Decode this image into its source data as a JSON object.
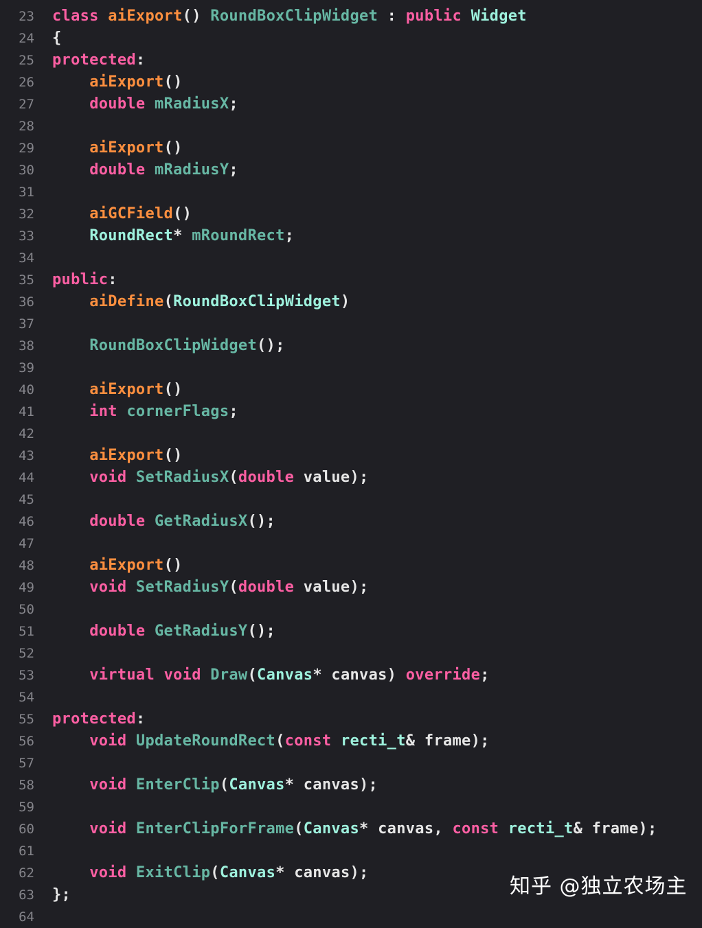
{
  "lines": [
    {
      "n": "23",
      "tokens": [
        [
          "kw",
          "class"
        ],
        [
          "id",
          " "
        ],
        [
          "mc",
          "aiExport"
        ],
        [
          "id",
          "() "
        ],
        [
          "fn",
          "RoundBoxClipWidget"
        ],
        [
          "id",
          " : "
        ],
        [
          "kw",
          "public"
        ],
        [
          "id",
          " "
        ],
        [
          "ty",
          "Widget"
        ]
      ]
    },
    {
      "n": "24",
      "tokens": [
        [
          "id",
          "{"
        ]
      ]
    },
    {
      "n": "25",
      "tokens": [
        [
          "kw",
          "protected"
        ],
        [
          "id",
          ":"
        ]
      ]
    },
    {
      "n": "26",
      "tokens": [
        [
          "id",
          "    "
        ],
        [
          "mc",
          "aiExport"
        ],
        [
          "id",
          "()"
        ]
      ]
    },
    {
      "n": "27",
      "tokens": [
        [
          "id",
          "    "
        ],
        [
          "kw",
          "double"
        ],
        [
          "id",
          " "
        ],
        [
          "fn",
          "mRadiusX"
        ],
        [
          "id",
          ";"
        ]
      ]
    },
    {
      "n": "28",
      "tokens": []
    },
    {
      "n": "29",
      "tokens": [
        [
          "id",
          "    "
        ],
        [
          "mc",
          "aiExport"
        ],
        [
          "id",
          "()"
        ]
      ]
    },
    {
      "n": "30",
      "tokens": [
        [
          "id",
          "    "
        ],
        [
          "kw",
          "double"
        ],
        [
          "id",
          " "
        ],
        [
          "fn",
          "mRadiusY"
        ],
        [
          "id",
          ";"
        ]
      ]
    },
    {
      "n": "31",
      "tokens": []
    },
    {
      "n": "32",
      "tokens": [
        [
          "id",
          "    "
        ],
        [
          "mc",
          "aiGCField"
        ],
        [
          "id",
          "()"
        ]
      ]
    },
    {
      "n": "33",
      "tokens": [
        [
          "id",
          "    "
        ],
        [
          "ty",
          "RoundRect"
        ],
        [
          "id",
          "* "
        ],
        [
          "fn",
          "mRoundRect"
        ],
        [
          "id",
          ";"
        ]
      ]
    },
    {
      "n": "34",
      "tokens": []
    },
    {
      "n": "35",
      "tokens": [
        [
          "kw",
          "public"
        ],
        [
          "id",
          ":"
        ]
      ]
    },
    {
      "n": "36",
      "tokens": [
        [
          "id",
          "    "
        ],
        [
          "mc",
          "aiDefine"
        ],
        [
          "id",
          "("
        ],
        [
          "ty",
          "RoundBoxClipWidget"
        ],
        [
          "id",
          ")"
        ]
      ]
    },
    {
      "n": "37",
      "tokens": []
    },
    {
      "n": "38",
      "tokens": [
        [
          "id",
          "    "
        ],
        [
          "fn",
          "RoundBoxClipWidget"
        ],
        [
          "id",
          "();"
        ]
      ]
    },
    {
      "n": "39",
      "tokens": []
    },
    {
      "n": "40",
      "tokens": [
        [
          "id",
          "    "
        ],
        [
          "mc",
          "aiExport"
        ],
        [
          "id",
          "()"
        ]
      ]
    },
    {
      "n": "41",
      "tokens": [
        [
          "id",
          "    "
        ],
        [
          "kw",
          "int"
        ],
        [
          "id",
          " "
        ],
        [
          "fn",
          "cornerFlags"
        ],
        [
          "id",
          ";"
        ]
      ]
    },
    {
      "n": "42",
      "tokens": []
    },
    {
      "n": "43",
      "tokens": [
        [
          "id",
          "    "
        ],
        [
          "mc",
          "aiExport"
        ],
        [
          "id",
          "()"
        ]
      ]
    },
    {
      "n": "44",
      "tokens": [
        [
          "id",
          "    "
        ],
        [
          "kw",
          "void"
        ],
        [
          "id",
          " "
        ],
        [
          "fn",
          "SetRadiusX"
        ],
        [
          "id",
          "("
        ],
        [
          "kw",
          "double"
        ],
        [
          "id",
          " value);"
        ]
      ]
    },
    {
      "n": "45",
      "tokens": []
    },
    {
      "n": "46",
      "tokens": [
        [
          "id",
          "    "
        ],
        [
          "kw",
          "double"
        ],
        [
          "id",
          " "
        ],
        [
          "fn",
          "GetRadiusX"
        ],
        [
          "id",
          "();"
        ]
      ]
    },
    {
      "n": "47",
      "tokens": []
    },
    {
      "n": "48",
      "tokens": [
        [
          "id",
          "    "
        ],
        [
          "mc",
          "aiExport"
        ],
        [
          "id",
          "()"
        ]
      ]
    },
    {
      "n": "49",
      "tokens": [
        [
          "id",
          "    "
        ],
        [
          "kw",
          "void"
        ],
        [
          "id",
          " "
        ],
        [
          "fn",
          "SetRadiusY"
        ],
        [
          "id",
          "("
        ],
        [
          "kw",
          "double"
        ],
        [
          "id",
          " value);"
        ]
      ]
    },
    {
      "n": "50",
      "tokens": []
    },
    {
      "n": "51",
      "tokens": [
        [
          "id",
          "    "
        ],
        [
          "kw",
          "double"
        ],
        [
          "id",
          " "
        ],
        [
          "fn",
          "GetRadiusY"
        ],
        [
          "id",
          "();"
        ]
      ]
    },
    {
      "n": "52",
      "tokens": []
    },
    {
      "n": "53",
      "tokens": [
        [
          "id",
          "    "
        ],
        [
          "kw",
          "virtual"
        ],
        [
          "id",
          " "
        ],
        [
          "kw",
          "void"
        ],
        [
          "id",
          " "
        ],
        [
          "fn",
          "Draw"
        ],
        [
          "id",
          "("
        ],
        [
          "ty",
          "Canvas"
        ],
        [
          "id",
          "* canvas) "
        ],
        [
          "kw",
          "override"
        ],
        [
          "id",
          ";"
        ]
      ]
    },
    {
      "n": "54",
      "tokens": []
    },
    {
      "n": "55",
      "tokens": [
        [
          "kw",
          "protected"
        ],
        [
          "id",
          ":"
        ]
      ]
    },
    {
      "n": "56",
      "tokens": [
        [
          "id",
          "    "
        ],
        [
          "kw",
          "void"
        ],
        [
          "id",
          " "
        ],
        [
          "fn",
          "UpdateRoundRect"
        ],
        [
          "id",
          "("
        ],
        [
          "kw",
          "const"
        ],
        [
          "id",
          " "
        ],
        [
          "ty",
          "recti_t"
        ],
        [
          "id",
          "& frame);"
        ]
      ]
    },
    {
      "n": "57",
      "tokens": []
    },
    {
      "n": "58",
      "tokens": [
        [
          "id",
          "    "
        ],
        [
          "kw",
          "void"
        ],
        [
          "id",
          " "
        ],
        [
          "fn",
          "EnterClip"
        ],
        [
          "id",
          "("
        ],
        [
          "ty",
          "Canvas"
        ],
        [
          "id",
          "* canvas);"
        ]
      ]
    },
    {
      "n": "59",
      "tokens": []
    },
    {
      "n": "60",
      "tokens": [
        [
          "id",
          "    "
        ],
        [
          "kw",
          "void"
        ],
        [
          "id",
          " "
        ],
        [
          "fn",
          "EnterClipForFrame"
        ],
        [
          "id",
          "("
        ],
        [
          "ty",
          "Canvas"
        ],
        [
          "id",
          "* canvas, "
        ],
        [
          "kw",
          "const"
        ],
        [
          "id",
          " "
        ],
        [
          "ty",
          "recti_t"
        ],
        [
          "id",
          "& frame);"
        ]
      ]
    },
    {
      "n": "61",
      "tokens": []
    },
    {
      "n": "62",
      "tokens": [
        [
          "id",
          "    "
        ],
        [
          "kw",
          "void"
        ],
        [
          "id",
          " "
        ],
        [
          "fn",
          "ExitClip"
        ],
        [
          "id",
          "("
        ],
        [
          "ty",
          "Canvas"
        ],
        [
          "id",
          "* canvas);"
        ]
      ]
    },
    {
      "n": "63",
      "tokens": [
        [
          "id",
          "};"
        ]
      ]
    },
    {
      "n": "64",
      "tokens": []
    }
  ],
  "watermark": "知乎 @独立农场主",
  "colors": {
    "background": "#1f1f24",
    "keyword": "#fc5fa3",
    "macro": "#fd8f3f",
    "type": "#9ef1dd",
    "function": "#67b7a4",
    "plain": "#e6e6e6",
    "line_number": "#84848a"
  }
}
